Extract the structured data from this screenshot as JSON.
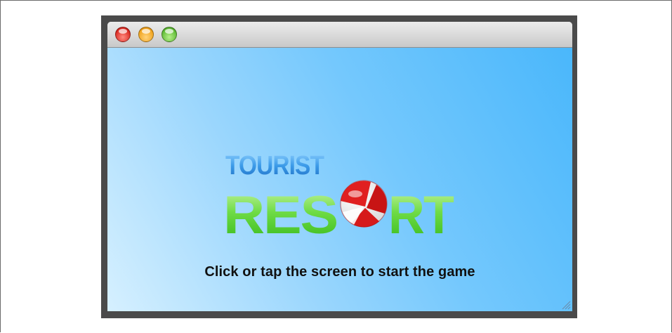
{
  "logo": {
    "line1": "TOURIST",
    "line2_prefix": "RES",
    "line2_suffix": "RT"
  },
  "game": {
    "instruction": "Click or tap the screen to start the game"
  },
  "icons": {
    "close": "close-icon",
    "minimize": "minimize-icon",
    "maximize": "maximize-icon",
    "beach_ball": "beach-ball-icon",
    "resize": "resize-grip-icon"
  },
  "colors": {
    "sky_light": "#d6f0ff",
    "sky_dark": "#4ab7fb",
    "logo_blue": "#2f8fe0",
    "logo_green": "#5fd03a",
    "ball_red": "#d21a1a"
  }
}
